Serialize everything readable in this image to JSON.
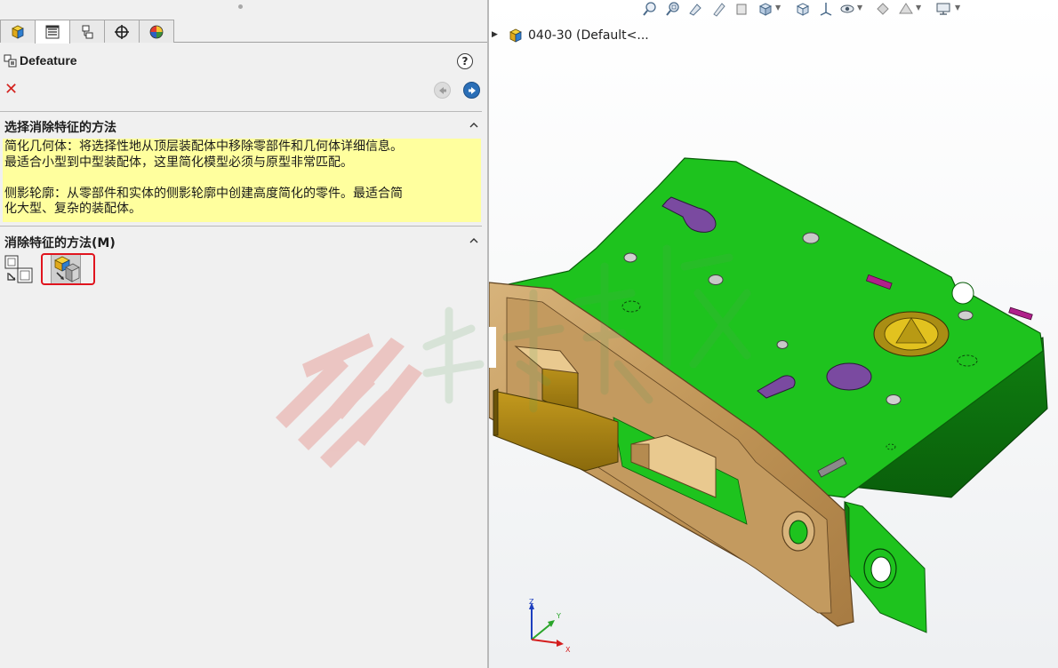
{
  "manager_tabs": [
    {
      "name": "feature-manager",
      "icon": "part-icon"
    },
    {
      "name": "property-manager",
      "icon": "property-list-icon"
    },
    {
      "name": "configuration-manager",
      "icon": "configuration-icon"
    },
    {
      "name": "dimxpert-manager",
      "icon": "crosshair-icon"
    },
    {
      "name": "display-manager",
      "icon": "appearance-ball-icon"
    }
  ],
  "property_manager": {
    "title": "Defeature",
    "help_label": "?",
    "cancel_label": "✕"
  },
  "section_select": {
    "title": "选择消除特征的方法",
    "info_lines": [
      "简化几何体：将选择性地从顶层装配体中移除零部件和几何体详细信息。",
      "最适合小型到中型装配体，这里简化模型必须与原型非常匹配。",
      "侧影轮廓：从零部件和实体的侧影轮廓中创建高度简化的零件。最适合简",
      "化大型、复杂的装配体。"
    ]
  },
  "section_method": {
    "title": "消除特征的方法(M)",
    "options": [
      {
        "name": "simplified-geometry",
        "icon": "simplified-geometry-icon",
        "selected": false
      },
      {
        "name": "silhouette",
        "icon": "silhouette-icon",
        "selected": true
      }
    ]
  },
  "tree": {
    "item_label": "040-30  (Default<..."
  },
  "triad_axes": {
    "z": "Z",
    "y": "Y",
    "x": "X"
  },
  "colors": {
    "info_highlight": "#ffff9e",
    "selection_outline": "#e0141e",
    "model_green": "#1ec31e",
    "model_brass": "#c9a36b",
    "next_button_blue": "#2b6fb7"
  }
}
